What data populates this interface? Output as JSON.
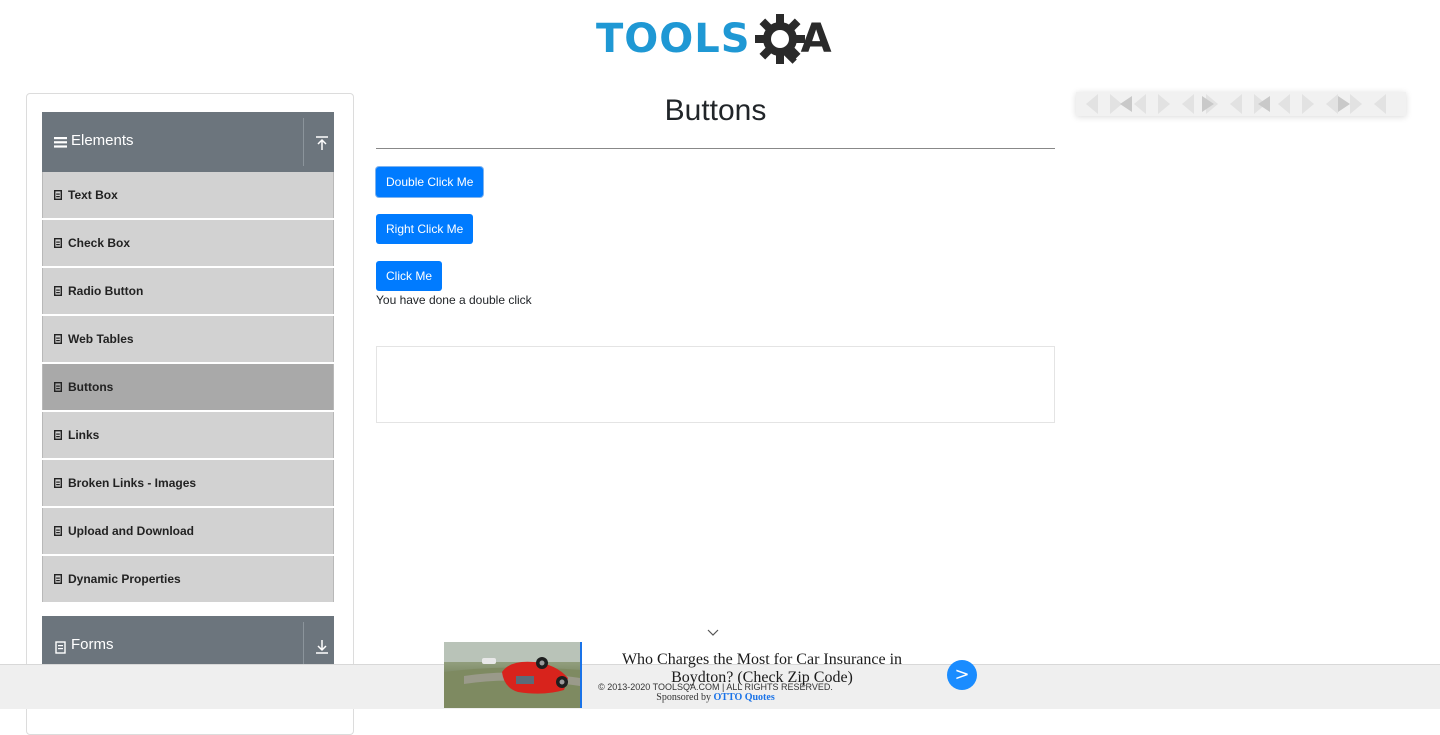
{
  "brand": {
    "logo_text_left": "TOOLS",
    "logo_text_right": "A",
    "colors": {
      "tools_blue": "#1f98d4",
      "gear_dark": "#2a2a2a"
    }
  },
  "sidebar": {
    "groups": [
      {
        "title": "Elements",
        "icon": "hamburger-icon",
        "arrow": "collapse-up-icon"
      },
      {
        "title": "Forms",
        "icon": "document-icon",
        "arrow": "expand-down-icon"
      }
    ],
    "items": [
      {
        "label": "Text Box",
        "active": false
      },
      {
        "label": "Check Box",
        "active": false
      },
      {
        "label": "Radio Button",
        "active": false
      },
      {
        "label": "Web Tables",
        "active": false
      },
      {
        "label": "Buttons",
        "active": true
      },
      {
        "label": "Links",
        "active": false
      },
      {
        "label": "Broken Links - Images",
        "active": false
      },
      {
        "label": "Upload and Download",
        "active": false
      },
      {
        "label": "Dynamic Properties",
        "active": false
      }
    ]
  },
  "main": {
    "title": "Buttons",
    "buttons": {
      "double_click": "Double Click Me",
      "right_click": "Right Click Me",
      "click": "Click Me"
    },
    "message": "You have done a double click",
    "colors": {
      "button_blue": "#007bff"
    }
  },
  "bottom_ad": {
    "headline": "Who Charges the Most for Car Insurance in Boydton? (Check Zip Code)",
    "go": ">",
    "image": "overturned-car-image"
  },
  "footer": {
    "copyright": "© 2013-2020 TOOLSQA.COM | ALL RIGHTS RESERVED.",
    "sponsored_prefix": "Sponsored by",
    "sponsor": "OTTO Quotes"
  }
}
